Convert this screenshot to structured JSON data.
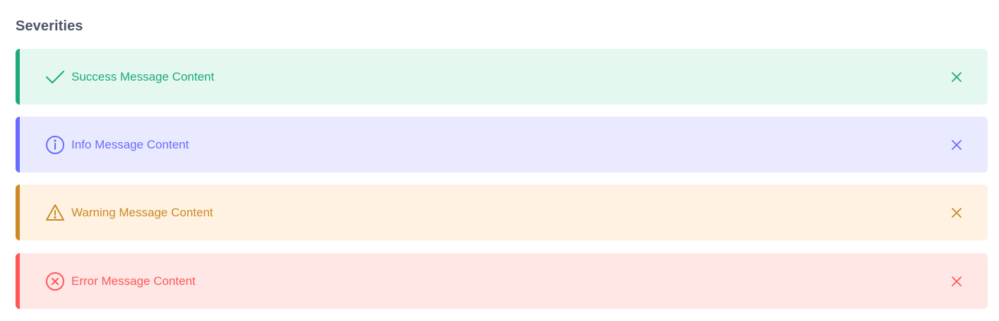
{
  "section": {
    "title": "Severities"
  },
  "messages": [
    {
      "severity": "success",
      "text": "Success Message Content",
      "icon": "check-icon",
      "color": "#1ea97c",
      "background": "#e4f8f0"
    },
    {
      "severity": "info",
      "text": "Info Message Content",
      "icon": "info-circle-icon",
      "color": "#696cff",
      "background": "#e9e9ff"
    },
    {
      "severity": "warn",
      "text": "Warning Message Content",
      "icon": "warning-triangle-icon",
      "color": "#cc8925",
      "background": "#fff2e2"
    },
    {
      "severity": "error",
      "text": "Error Message Content",
      "icon": "times-circle-icon",
      "color": "#ff5757",
      "background": "#ffe7e6"
    }
  ],
  "close_icon": "close-icon"
}
